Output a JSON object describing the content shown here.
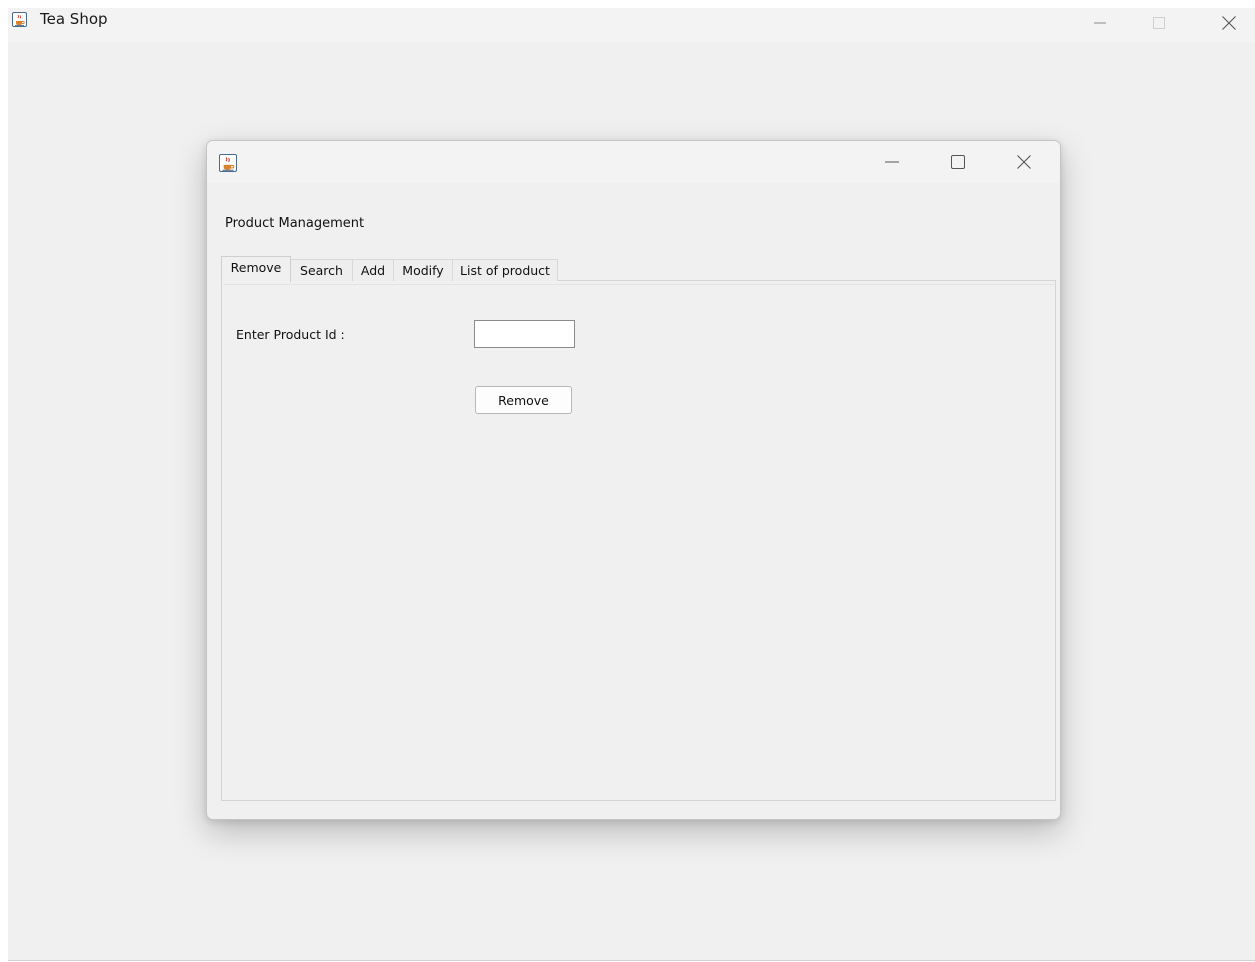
{
  "main_window": {
    "title": "Tea Shop",
    "icon": "java-cup-icon",
    "controls": [
      "minimize-icon",
      "maximize-icon",
      "close-icon"
    ]
  },
  "dialog": {
    "icon": "java-cup-icon",
    "title": "",
    "controls": [
      "minimize-icon",
      "maximize-icon",
      "close-icon"
    ],
    "heading": "Product Management",
    "tabs": [
      {
        "label": "Remove",
        "selected": true
      },
      {
        "label": "Search",
        "selected": false
      },
      {
        "label": "Add",
        "selected": false
      },
      {
        "label": "Modify",
        "selected": false
      },
      {
        "label": "List of product",
        "selected": false
      }
    ],
    "remove_panel": {
      "product_id_label": "Enter Product Id :",
      "product_id_value": "",
      "remove_button_label": "Remove"
    }
  },
  "colors": {
    "window_background": "#f0f0f0",
    "titlebar_background": "#f3f3f3",
    "border": "#c4c4c4",
    "text": "#111111"
  }
}
